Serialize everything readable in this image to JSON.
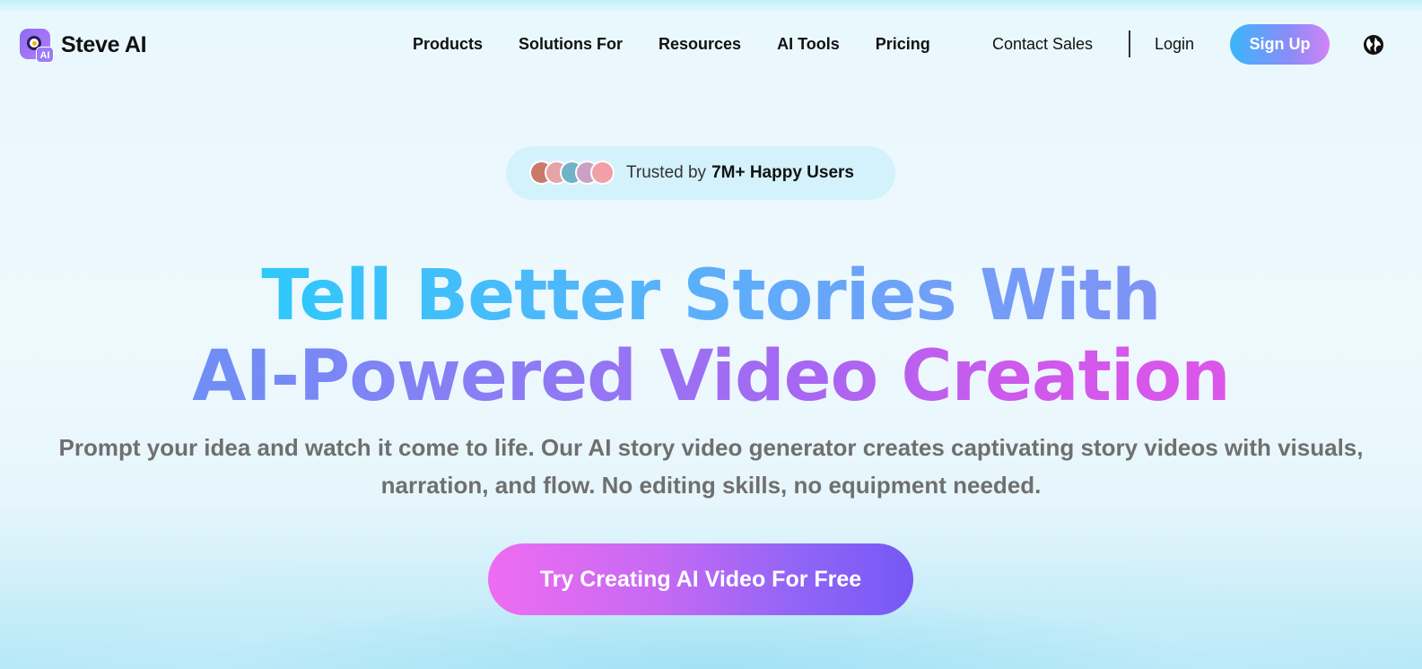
{
  "header": {
    "logo_text": "Steve AI",
    "logo_badge": "AI",
    "nav": [
      "Products",
      "Solutions For",
      "Resources",
      "AI Tools",
      "Pricing"
    ],
    "contact_label": "Contact Sales",
    "login_label": "Login",
    "signup_label": "Sign Up"
  },
  "badge": {
    "prefix": "Trusted by",
    "highlight": "7M+ Happy Users",
    "avatar_colors": [
      "#c97a6a",
      "#e7a4a7",
      "#6fb3c7",
      "#c9a1c4",
      "#f1a0a8"
    ]
  },
  "hero": {
    "headline_line1": "Tell Better Stories With",
    "headline_line2": "AI-Powered Video Creation",
    "subheadline": "Prompt your idea and watch it come to life. Our AI story video generator creates captivating story videos with visuals, narration, and flow. No editing skills, no equipment needed.",
    "cta_label": "Try Creating AI Video For Free"
  },
  "colors": {
    "signup_gradient": [
      "#3bb5fb",
      "#d083f5"
    ],
    "cta_gradient": [
      "#ef6cf1",
      "#7658f5"
    ],
    "headline_blue": "#2ec9fb",
    "headline_pink": "#dd55ea"
  },
  "icons": {
    "globe": "globe-icon",
    "logo": "steve-ai-logo-icon"
  }
}
